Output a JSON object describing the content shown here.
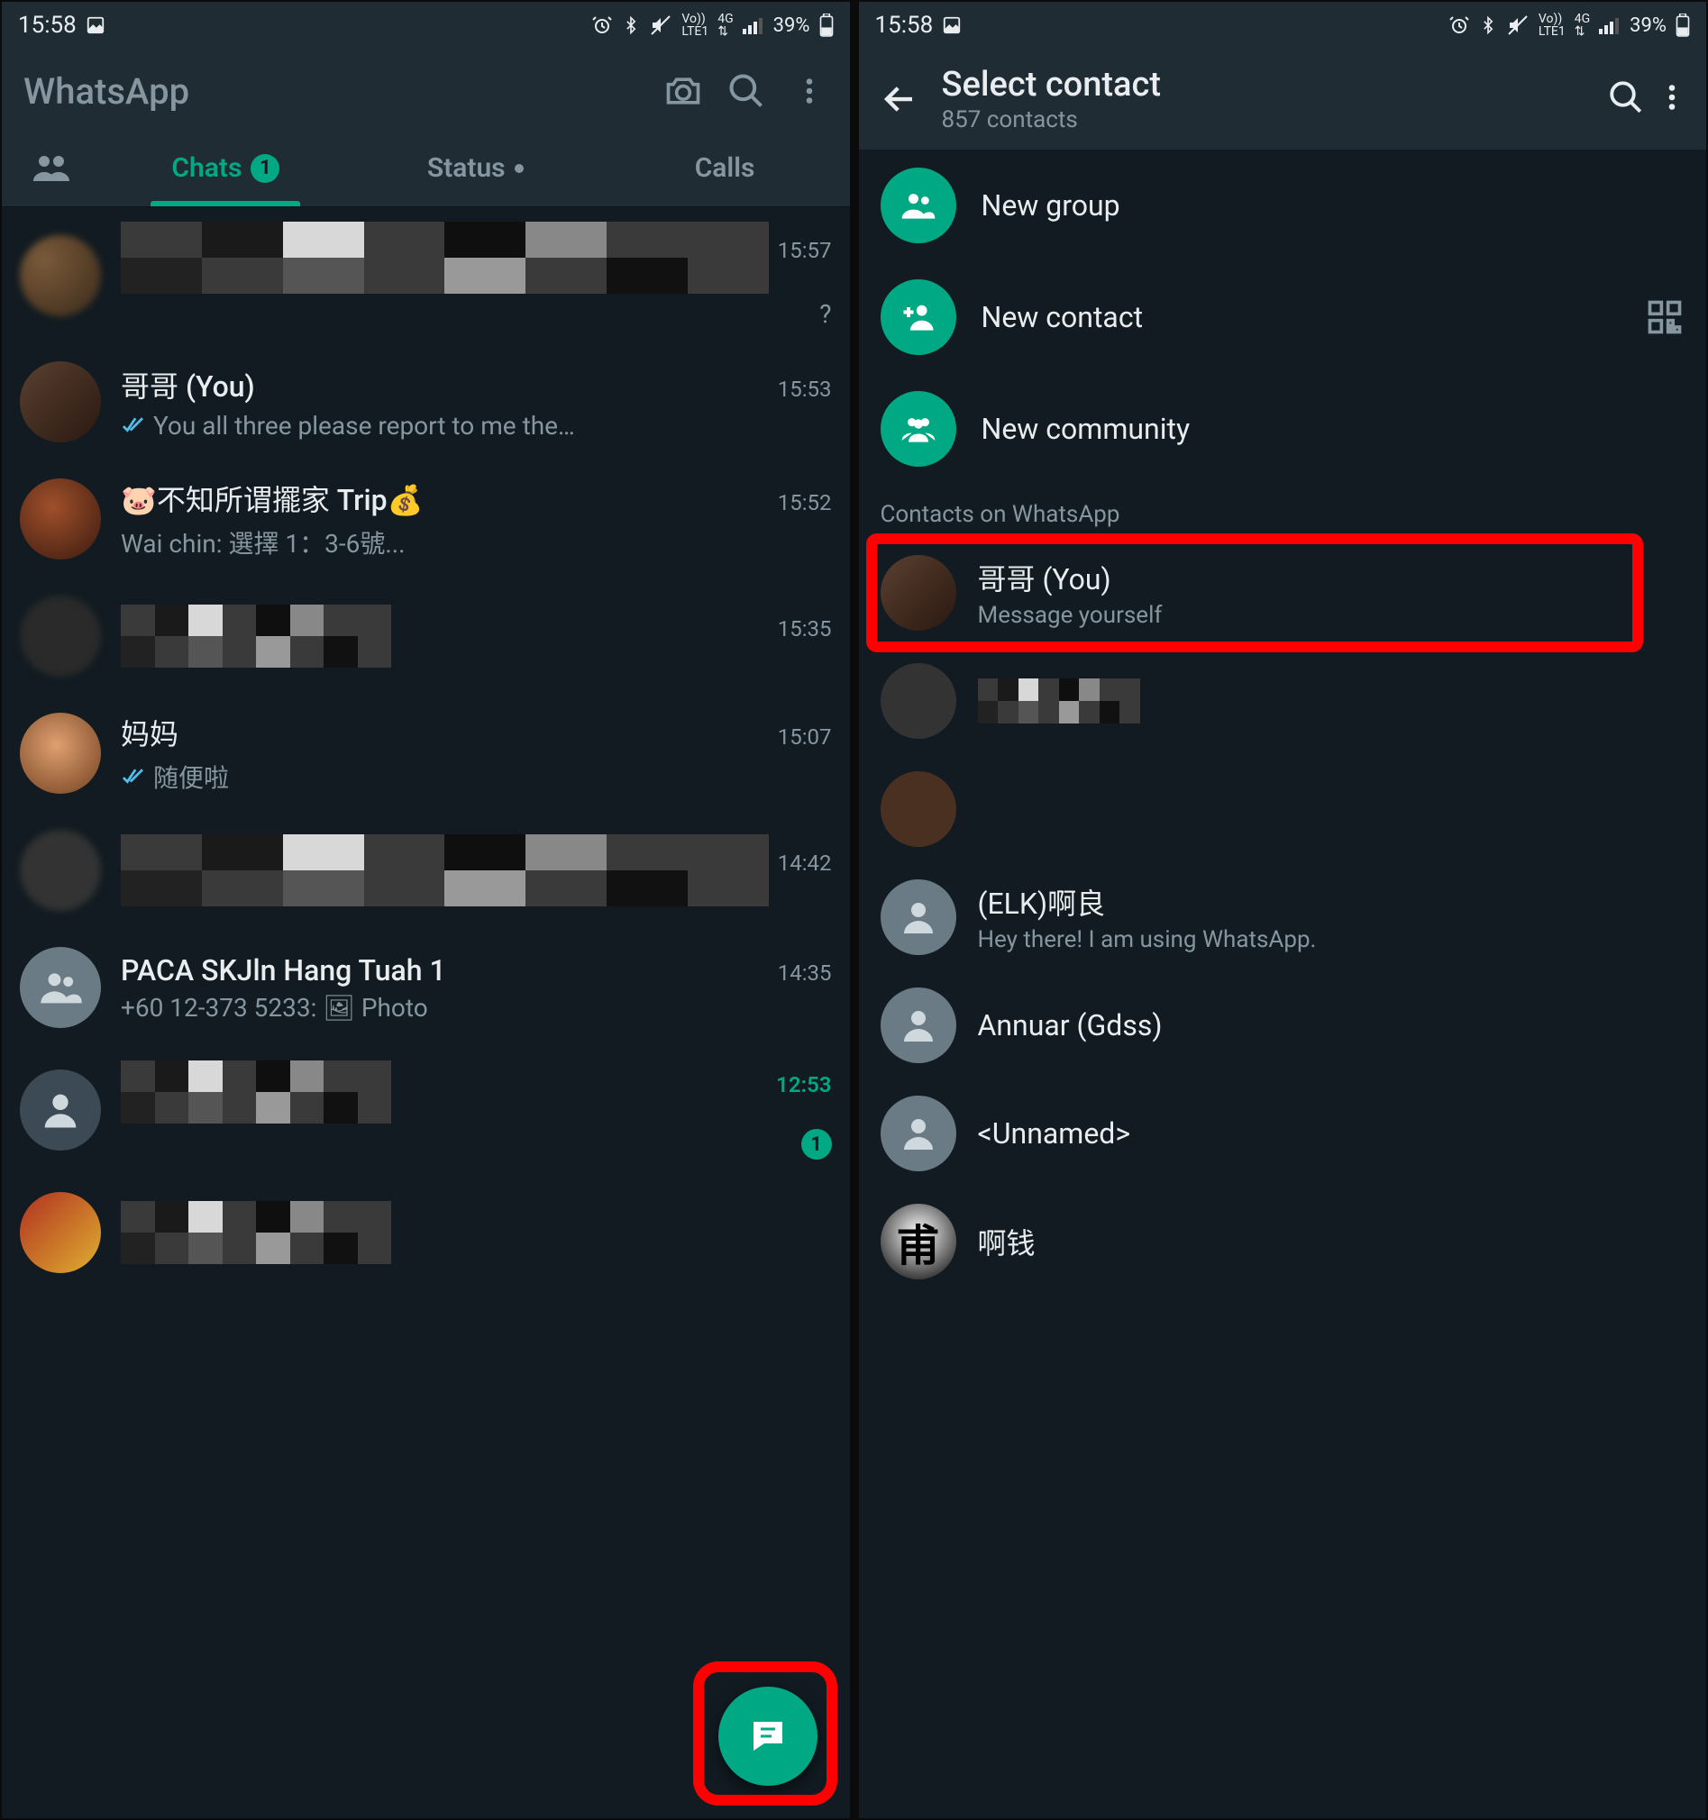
{
  "statusBar": {
    "time": "15:58",
    "battery": "39%"
  },
  "left": {
    "appTitle": "WhatsApp",
    "tabs": {
      "chats": "Chats",
      "chatsBadge": "1",
      "status": "Status",
      "calls": "Calls"
    },
    "chats": [
      {
        "name": "",
        "time": "15:57",
        "msg": "?",
        "censored": true
      },
      {
        "name": "哥哥 (You)",
        "time": "15:53",
        "msg": "You all three please report to me the…",
        "ticks": true
      },
      {
        "name": "🐷不知所谓擺家 Trip💰",
        "time": "15:52",
        "msg": "Wai chin: 選擇 1：3-6號..."
      },
      {
        "name": "",
        "time": "15:35",
        "msg": "",
        "censored": true
      },
      {
        "name": "妈妈",
        "time": "15:07",
        "msg": "随便啦",
        "ticks": true
      },
      {
        "name": "",
        "time": "14:42",
        "msg": "",
        "censored": true
      },
      {
        "name": "PACA SKJln Hang Tuah 1",
        "time": "14:35",
        "msg": "+60 12-373 5233: 🖼 Photo",
        "group": true
      },
      {
        "name": "",
        "time": "12:53",
        "msg": "",
        "censored": true,
        "unread": "1",
        "unreadTime": true
      },
      {
        "name": "",
        "time": "",
        "msg": "",
        "censored": true
      }
    ]
  },
  "right": {
    "title": "Select contact",
    "subtitle": "857 contacts",
    "actions": {
      "newGroup": "New group",
      "newContact": "New contact",
      "newCommunity": "New community"
    },
    "sectionHeader": "Contacts on WhatsApp",
    "contacts": [
      {
        "name": "哥哥 (You)",
        "sub": "Message yourself",
        "highlight": true
      },
      {
        "name": "",
        "sub": "",
        "censored": true
      },
      {
        "name": "",
        "sub": "",
        "censored": true
      },
      {
        "name": "(ELK)啊良",
        "sub": "Hey there! I am using WhatsApp."
      },
      {
        "name": "Annuar (Gdss)",
        "sub": ""
      },
      {
        "name": "<Unnamed>",
        "sub": ""
      },
      {
        "name": "啊钱",
        "sub": ""
      }
    ]
  }
}
